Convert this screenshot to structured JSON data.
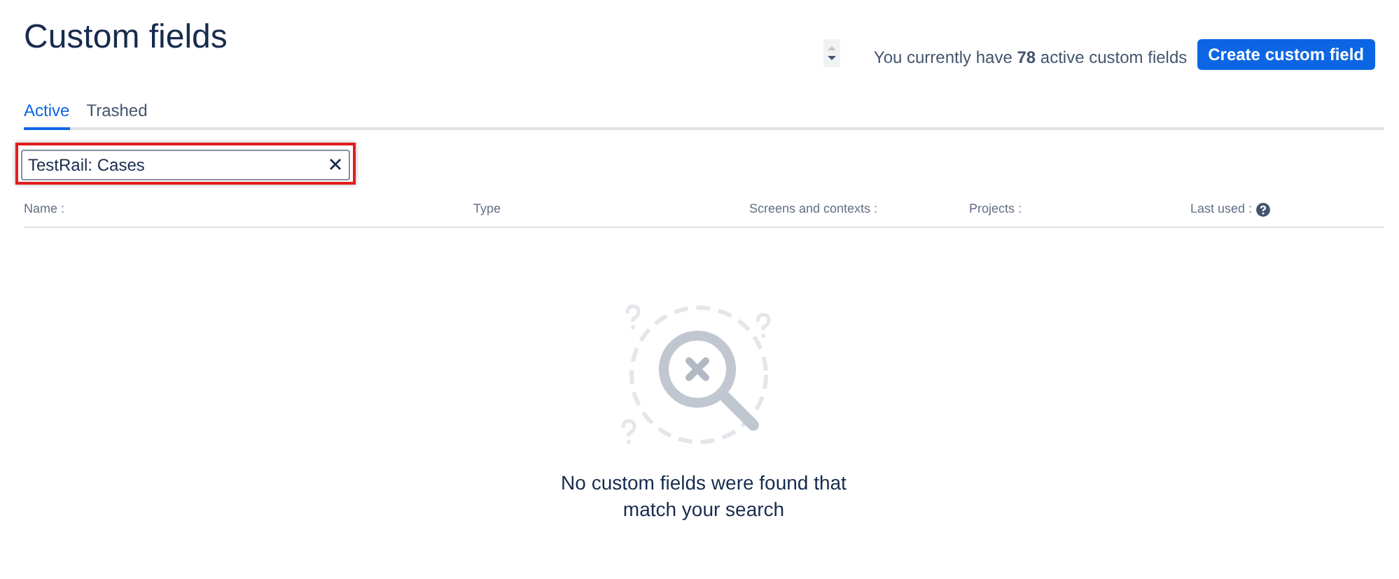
{
  "page_title": "Custom fields",
  "count_text": "You currently have **78** active custom fields",
  "create_button": "Create custom field",
  "tabs": [
    {
      "label": "Active",
      "selected": true
    },
    {
      "label": "Trashed",
      "selected": false
    }
  ],
  "search": {
    "value": "TestRail: Cases"
  },
  "table": {
    "columns": [
      {
        "label": "Name :",
        "kind": "plain"
      },
      {
        "label": "Type",
        "kind": "plain"
      },
      {
        "label": "Screens and contexts :",
        "kind": "plain"
      },
      {
        "label": "Projects :",
        "kind": "plain"
      },
      {
        "label": "Last used :",
        "kind": "help"
      }
    ]
  },
  "empty_state": {
    "message": "No custom fields were found that match your search"
  }
}
